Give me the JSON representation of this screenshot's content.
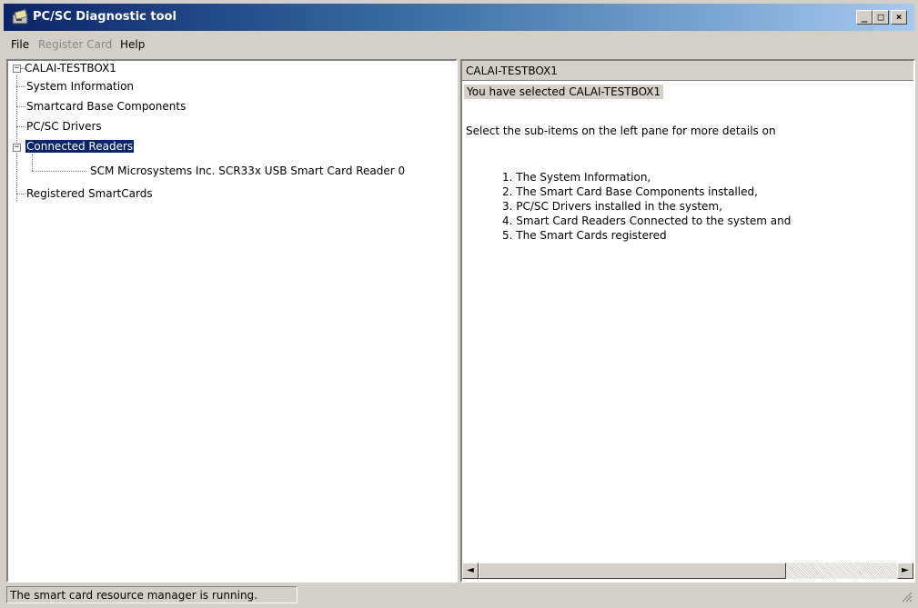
{
  "window": {
    "title": "PC/SC Diagnostic tool"
  },
  "caption_buttons": {
    "minimize": "_",
    "maximize": "□",
    "close": "×"
  },
  "menu": {
    "file": "File",
    "register_card": "Register Card",
    "help": "Help"
  },
  "tree": {
    "root": {
      "label": "CALAI-TESTBOX1",
      "expander": "−"
    },
    "system_information": "System Information",
    "smartcard_base_components": "Smartcard Base Components",
    "pcsc_drivers": "PC/SC Drivers",
    "connected_readers": {
      "label": "Connected Readers",
      "expander": "−"
    },
    "reader_0": "SCM Microsystems Inc. SCR33x USB Smart Card Reader 0",
    "registered_smartcards": "Registered SmartCards"
  },
  "details": {
    "header": "CALAI-TESTBOX1",
    "selected": "You have selected CALAI-TESTBOX1",
    "intro": "Select the sub-items on the left pane for more details on",
    "items": [
      "1. The System Information,",
      "2. The Smart Card Base Components installed,",
      "3. PC/SC Drivers installed in the system,",
      "4. Smart Card Readers Connected to the system and",
      "5. The Smart Cards registered"
    ]
  },
  "scrollbar": {
    "left_arrow": "◄",
    "right_arrow": "►"
  },
  "status": {
    "text": "The smart card resource manager is running."
  },
  "colors": {
    "title_gradient_start": "#0a246a",
    "title_gradient_end": "#a6caf0",
    "selection": "#0a246a",
    "face": "#d4d0c8"
  }
}
